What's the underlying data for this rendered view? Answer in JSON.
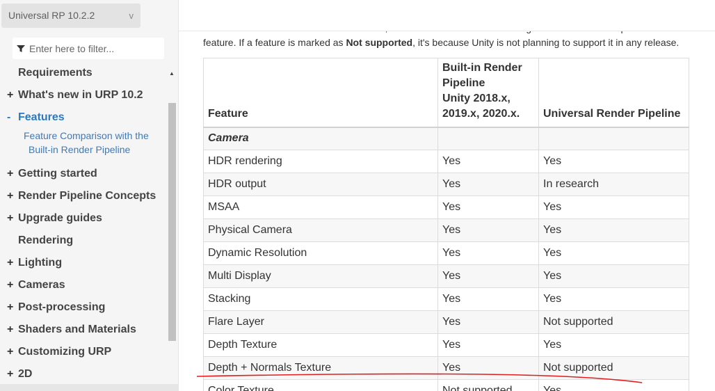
{
  "sidebar": {
    "version": "Universal RP 10.2.2",
    "version_chevron": "v",
    "filter_placeholder": "Enter here to filter...",
    "items": [
      {
        "prefix": "",
        "label": "Requirements"
      },
      {
        "prefix": "+",
        "label": "What's new in URP 10.2"
      },
      {
        "prefix": "-",
        "label": "Features",
        "active": true
      },
      {
        "prefix": "+",
        "label": "Getting started"
      },
      {
        "prefix": "+",
        "label": "Render Pipeline Concepts"
      },
      {
        "prefix": "+",
        "label": "Upgrade guides"
      },
      {
        "prefix": "",
        "label": "Rendering"
      },
      {
        "prefix": "+",
        "label": "Lighting"
      },
      {
        "prefix": "+",
        "label": "Cameras"
      },
      {
        "prefix": "+",
        "label": "Post-processing"
      },
      {
        "prefix": "+",
        "label": "Shaders and Materials"
      },
      {
        "prefix": "+",
        "label": "Customizing URP"
      },
      {
        "prefix": "+",
        "label": "2D"
      }
    ],
    "subitem": {
      "line1": "Feature Comparison with the",
      "line2": "Built-in Render Pipeline"
    }
  },
  "content": {
    "intro_cut": "Note: If a feature is marked as In research, the URP team is still researching how and when to implement the",
    "intro_pre": "feature. If a feature is marked as ",
    "intro_bold": "Not supported",
    "intro_post": ", it's because Unity is not planning to support it in any release.",
    "table": {
      "headers": {
        "feature": "Feature",
        "builtin_1": "Built-in Render",
        "builtin_2": "Pipeline",
        "builtin_3": "Unity 2018.x,",
        "builtin_4": "2019.x, 2020.x.",
        "urp": "Universal Render Pipeline"
      },
      "category": "Camera",
      "rows": [
        {
          "feature": "HDR rendering",
          "builtin": "Yes",
          "urp": "Yes"
        },
        {
          "feature": "HDR output",
          "builtin": "Yes",
          "urp": "In research"
        },
        {
          "feature": "MSAA",
          "builtin": "Yes",
          "urp": "Yes"
        },
        {
          "feature": "Physical Camera",
          "builtin": "Yes",
          "urp": "Yes"
        },
        {
          "feature": "Dynamic Resolution",
          "builtin": "Yes",
          "urp": "Yes"
        },
        {
          "feature": "Multi Display",
          "builtin": "Yes",
          "urp": "Yes"
        },
        {
          "feature": "Stacking",
          "builtin": "Yes",
          "urp": "Yes"
        },
        {
          "feature": "Flare Layer",
          "builtin": "Yes",
          "urp": "Not supported"
        },
        {
          "feature": "Depth Texture",
          "builtin": "Yes",
          "urp": "Yes"
        },
        {
          "feature": "Depth + Normals Texture",
          "builtin": "Yes",
          "urp": "Not supported"
        },
        {
          "feature": "Color Texture",
          "builtin": "Not supported",
          "urp": "Yes"
        }
      ]
    }
  },
  "colors": {
    "active_link": "#2b79c1",
    "annotation": "#e01e1e"
  }
}
